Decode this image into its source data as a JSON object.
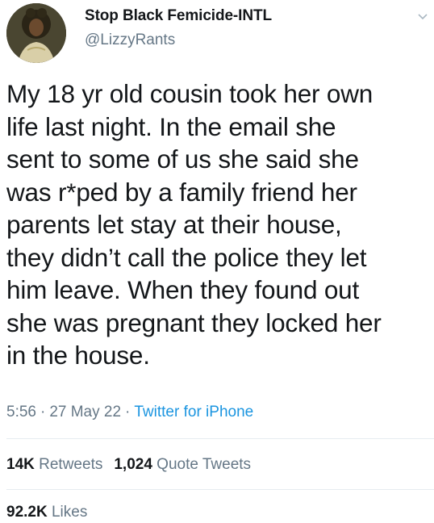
{
  "author": {
    "display_name": "Stop Black Femicide-INTL",
    "handle": "@LizzyRants"
  },
  "tweet": {
    "text": "My 18 yr old cousin took her own\nlife last night. In the email she\nsent to some of us she said she\nwas r*ped by a family friend her\nparents let stay at their house,\nthey didn’t call the police they let\nhim leave. When they found out\nshe was pregnant they locked her\nin the house.",
    "time": "5:56",
    "date": "27 May 22",
    "source": "Twitter for iPhone",
    "separator": "·"
  },
  "stats": {
    "retweets_count": "14K",
    "retweets_label": "Retweets",
    "quote_count": "1,024",
    "quote_label": "Quote Tweets",
    "likes_count": "92.2K",
    "likes_label": "Likes"
  },
  "icons": {
    "menu": "chevron-down-icon",
    "avatar": "avatar"
  },
  "colors": {
    "text_primary": "#14171a",
    "text_secondary": "#657786",
    "link": "#1b95e0",
    "divider": "#e6ecf0"
  }
}
